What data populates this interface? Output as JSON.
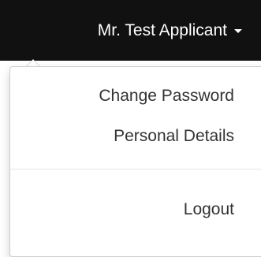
{
  "navbar": {
    "user_label": "Mr. Test Applicant",
    "background_color": "#111111",
    "caret_icon": "caret-down-icon"
  },
  "dropdown": {
    "items": [
      {
        "label": "Change Password"
      },
      {
        "label": "Personal Details"
      },
      {
        "label": "Logout"
      }
    ]
  }
}
